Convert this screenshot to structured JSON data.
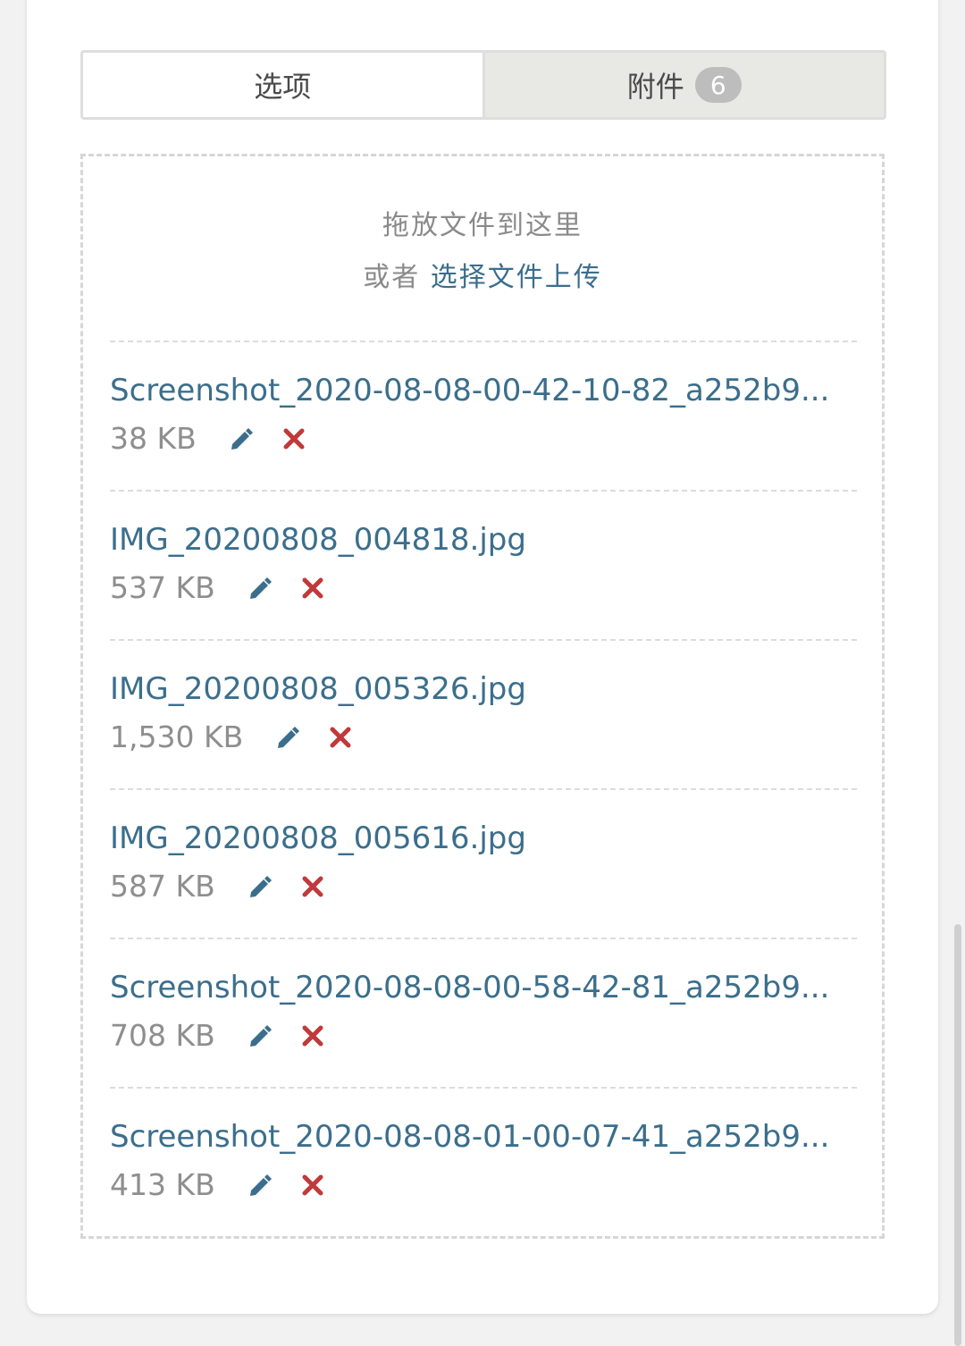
{
  "tabs": {
    "options_label": "选项",
    "attachments_label": "附件",
    "attachments_count": "6"
  },
  "dropzone": {
    "hint": "拖放文件到这里",
    "or_text": "或者",
    "upload_link": "选择文件上传"
  },
  "files": [
    {
      "name": "Screenshot_2020-08-08-00-42-10-82_a252b9...",
      "size": "38 KB"
    },
    {
      "name": "IMG_20200808_004818.jpg",
      "size": "537 KB"
    },
    {
      "name": "IMG_20200808_005326.jpg",
      "size": "1,530 KB"
    },
    {
      "name": "IMG_20200808_005616.jpg",
      "size": "587 KB"
    },
    {
      "name": "Screenshot_2020-08-08-00-58-42-81_a252b9...",
      "size": "708 KB"
    },
    {
      "name": "Screenshot_2020-08-08-01-00-07-41_a252b9...",
      "size": "413 KB"
    }
  ],
  "icons": {
    "edit": "pencil-icon",
    "delete": "close-icon"
  },
  "colors": {
    "link": "#3b6e8c",
    "delete": "#c0393b",
    "edit": "#3b6e8c"
  }
}
